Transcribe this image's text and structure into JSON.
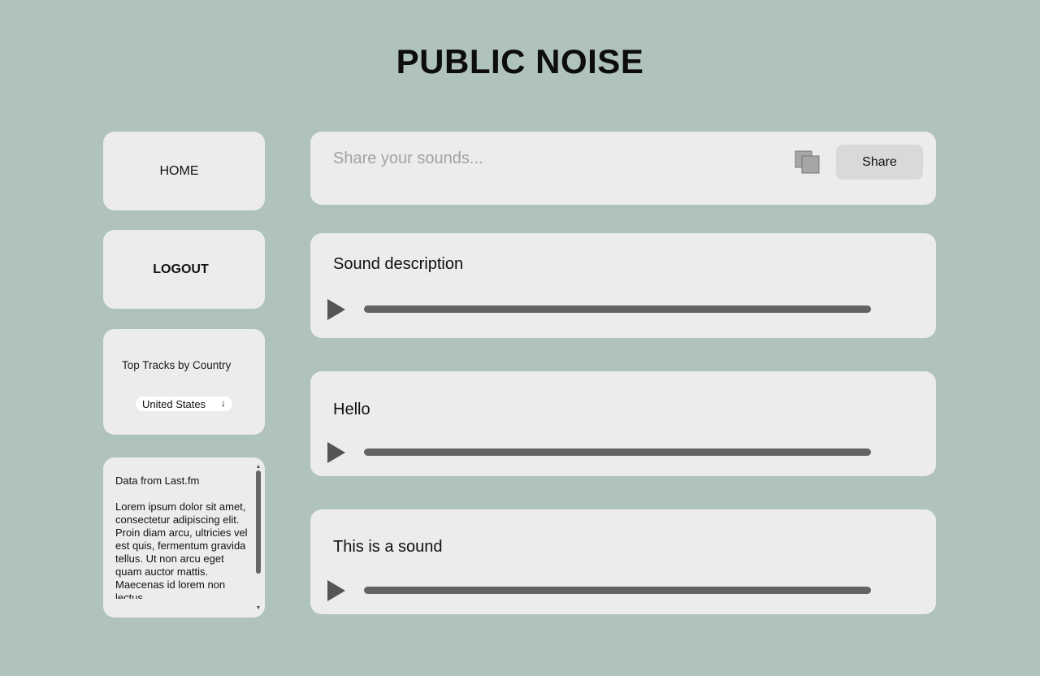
{
  "app": {
    "title": "PUBLIC NOISE"
  },
  "sidebar": {
    "home_label": "HOME",
    "logout_label": "LOGOUT",
    "top_tracks": {
      "label": "Top Tracks by Country",
      "selected_country": "United States",
      "arrow": "↓"
    },
    "lastfm": {
      "heading": "Data from Last.fm",
      "body": "Lorem ipsum dolor sit amet, consectetur adipiscing elit. Proin diam arcu, ultricies vel est quis, fermentum gravida tellus. Ut non arcu eget quam auctor mattis. Maecenas id lorem non lectus"
    }
  },
  "composer": {
    "placeholder": "Share your sounds...",
    "share_label": "Share",
    "attach_icon": "copy-icon"
  },
  "sounds": [
    {
      "title": "Sound description"
    },
    {
      "title": "Hello"
    },
    {
      "title": "This is a sound"
    }
  ],
  "colors": {
    "background": "#afc3ba",
    "card": "#ececec",
    "progress_bar": "#636363",
    "play_icon": "#555555",
    "share_button": "#d9d9d9"
  }
}
